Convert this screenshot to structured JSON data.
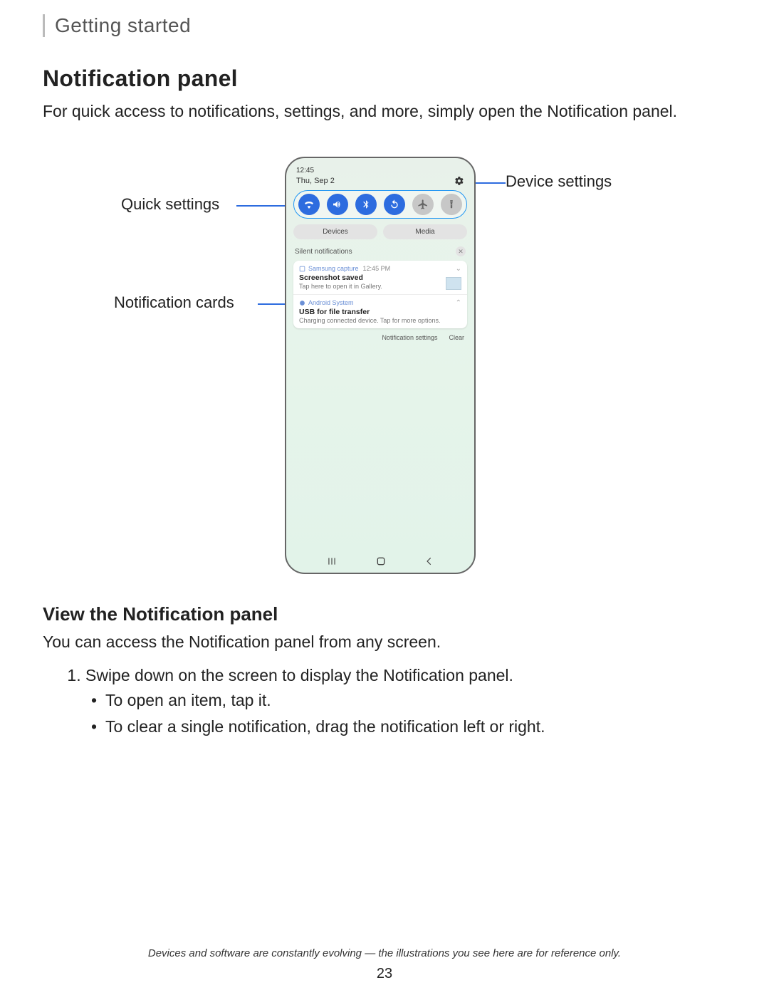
{
  "breadcrumb": "Getting started",
  "title": "Notification panel",
  "intro": "For quick access to notifications, settings, and more, simply open the Notification panel.",
  "callouts": {
    "quick_settings": "Quick settings",
    "device_settings": "Device settings",
    "notification_cards": "Notification cards"
  },
  "phone": {
    "time": "12:45",
    "date": "Thu, Sep 2",
    "tabs": {
      "devices": "Devices",
      "media": "Media"
    },
    "silent_label": "Silent notifications",
    "card1": {
      "app": "Samsung capture",
      "time": "12:45 PM",
      "title": "Screenshot saved",
      "sub": "Tap here to open it in Gallery."
    },
    "card2": {
      "app": "Android System",
      "title": "USB for file transfer",
      "sub": "Charging connected device. Tap for more options."
    },
    "links": {
      "settings": "Notification settings",
      "clear": "Clear"
    }
  },
  "subheading": "View the Notification panel",
  "sub_intro": "You can access the Notification panel from any screen.",
  "step1": "Swipe down on the screen to display the Notification panel.",
  "bullet1": "To open an item, tap it.",
  "bullet2": "To clear a single notification, drag the notification left or right.",
  "footer": "Devices and software are constantly evolving — the illustrations you see here are for reference only.",
  "page_number": "23"
}
